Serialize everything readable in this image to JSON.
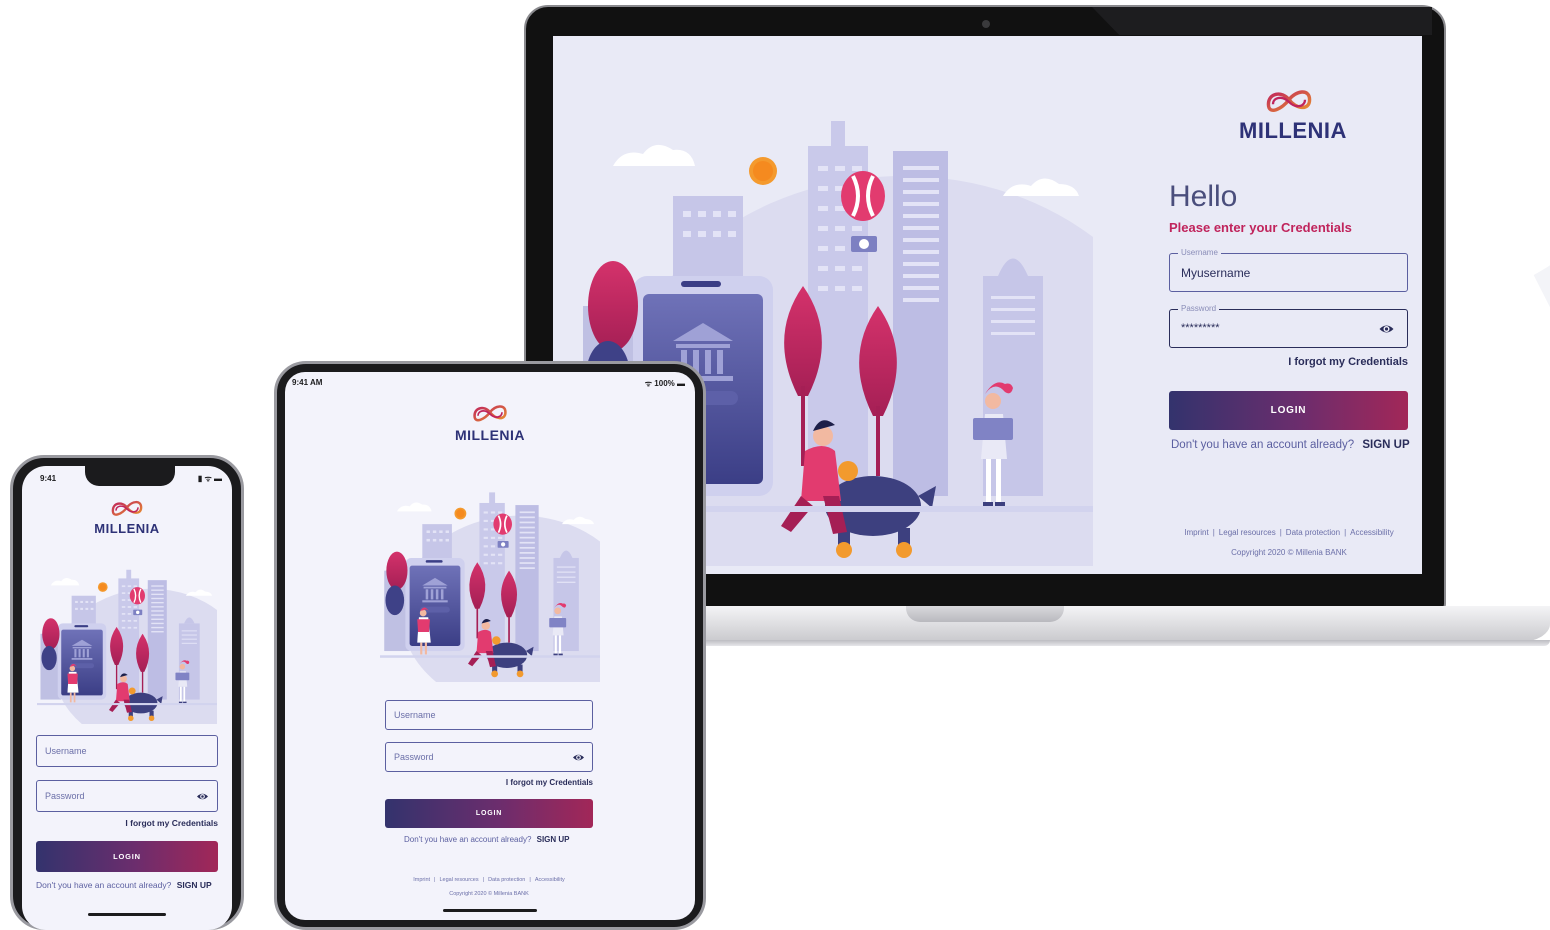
{
  "brand": {
    "name": "MILLENIA",
    "primary_color": "#2e3277",
    "accent_color": "#c0245c"
  },
  "desktop": {
    "greeting": "Hello",
    "subtitle": "Please enter your Credentials",
    "username": {
      "label": "Username",
      "value": "Myusername"
    },
    "password": {
      "label": "Password",
      "value": "*********"
    },
    "forgot": "I forgot my Credentials",
    "login": "LOGIN",
    "signup_prompt": "Don't you have an account already?",
    "signup": "SIGN UP",
    "footer": {
      "links": [
        "Imprint",
        "Legal resources",
        "Data protection",
        "Accessibility"
      ],
      "separator": "|"
    },
    "copyright": "Copyright 2020 © Millenia BANK"
  },
  "tablet": {
    "status": {
      "time": "9:41 AM",
      "battery": "100%"
    },
    "username_placeholder": "Username",
    "password_placeholder": "Password",
    "forgot": "I forgot my Credentials",
    "login": "LOGIN",
    "signup_prompt": "Don't you have an account already?",
    "signup": "SIGN UP",
    "footer": {
      "links": [
        "Imprint",
        "Legal resources",
        "Data protection",
        "Accessibility"
      ],
      "separator": "|"
    },
    "copyright": "Copyright 2020 © Millenia BANK"
  },
  "phone": {
    "status": {
      "time": "9:41"
    },
    "username_placeholder": "Username",
    "password_placeholder": "Password",
    "forgot": "I forgot my Credentials",
    "login": "LOGIN",
    "signup_prompt": "Don't you have an account already?",
    "signup": "SIGN UP"
  },
  "illustration": {
    "coin_label": "$"
  }
}
